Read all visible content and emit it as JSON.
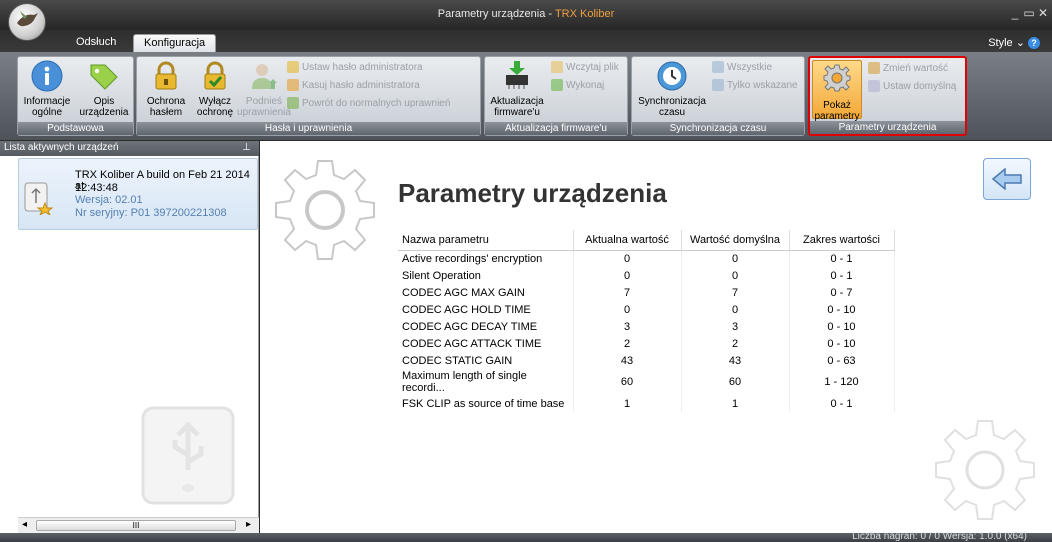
{
  "window": {
    "title_main": "Parametry urządzenia - ",
    "title_accent": "TRX Koliber",
    "minimize": "_",
    "maximize": "▭",
    "close": "✕"
  },
  "tabs": [
    {
      "label": "Odsłuch",
      "active": false
    },
    {
      "label": "Konfiguracja",
      "active": true
    }
  ],
  "style_menu": "Style",
  "ribbon": {
    "groups": [
      {
        "label": "Podstawowa",
        "buttons": [
          {
            "label1": "Informacje",
            "label2": "ogólne",
            "icon": "info-icon"
          },
          {
            "label1": "Opis",
            "label2": "urządzenia",
            "icon": "tag-icon"
          }
        ]
      },
      {
        "label": "Hasła i uprawnienia",
        "buttons": [
          {
            "label1": "Ochrona",
            "label2": "hasłem",
            "icon": "lock-icon"
          },
          {
            "label1": "Wyłącz",
            "label2": "ochronę",
            "icon": "unlock-icon"
          },
          {
            "label1": "Podnieś",
            "label2": "uprawnienia",
            "icon": "user-up-icon"
          }
        ],
        "small": [
          "Ustaw hasło administratora",
          "Kasuj hasło administratora",
          "Powrót do normalnych uprawnień"
        ]
      },
      {
        "label": "Aktualizacja firmware'u",
        "buttons": [
          {
            "label1": "Aktualizacja",
            "label2": "firmware'u",
            "icon": "chip-download-icon"
          }
        ],
        "small": [
          "Wczytaj plik",
          "Wykonaj"
        ]
      },
      {
        "label": "Synchronizacja czasu",
        "buttons": [
          {
            "label1": "Synchronizacja",
            "label2": "czasu",
            "icon": "sync-clock-icon"
          }
        ],
        "small": [
          "Wszystkie",
          "Tylko wskazane"
        ]
      },
      {
        "label": "Parametry urządzenia",
        "buttons": [
          {
            "label1": "Pokaż",
            "label2": "parametry",
            "icon": "gear-icon"
          }
        ],
        "small": [
          "Zmień wartość",
          "Ustaw domyślną"
        ]
      }
    ]
  },
  "left_panel": {
    "header": "Lista aktywnych urządzeń",
    "pin": "⊥",
    "device": {
      "name": "TRX Koliber A build on Feb 21 2014 at",
      "time": "12:43:48",
      "version": "Wersja: 02.01",
      "serial": "Nr seryjny: P01 397200221308"
    },
    "scroll_grip": "III"
  },
  "main": {
    "title": "Parametry urządzenia",
    "table": {
      "headers": [
        "Nazwa parametru",
        "Aktualna wartość",
        "Wartość domyślna",
        "Zakres wartości"
      ],
      "rows": [
        [
          "Active recordings' encryption",
          "0",
          "0",
          "0 - 1"
        ],
        [
          "Silent Operation",
          "0",
          "0",
          "0 - 1"
        ],
        [
          "CODEC AGC MAX GAIN",
          "7",
          "7",
          "0 - 7"
        ],
        [
          "CODEC AGC HOLD TIME",
          "0",
          "0",
          "0 - 10"
        ],
        [
          "CODEC AGC DECAY TIME",
          "3",
          "3",
          "0 - 10"
        ],
        [
          "CODEC AGC ATTACK TIME",
          "2",
          "2",
          "0 - 10"
        ],
        [
          "CODEC STATIC GAIN",
          "43",
          "43",
          "0 - 63"
        ],
        [
          "Maximum length of single recordi...",
          "60",
          "60",
          "1 - 120"
        ],
        [
          "FSK CLIP as source of time base",
          "1",
          "1",
          "0 - 1"
        ]
      ]
    }
  },
  "statusbar": {
    "text": "Liczba nagrań: 0 / 0     Wersja: 1.0.0 (x64)"
  },
  "colors": {
    "accent": "#f0a040",
    "highlight": "#e00000",
    "selected": "#d7e6f5"
  }
}
